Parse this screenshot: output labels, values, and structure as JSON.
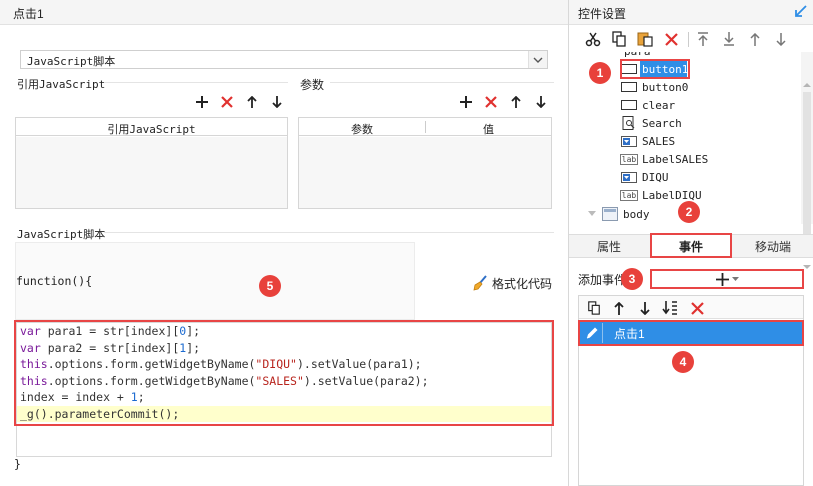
{
  "left": {
    "title": "点击1",
    "script_type_select": {
      "value": "JavaScript脚本"
    },
    "ref_js": {
      "title": "引用JavaScript",
      "column": "引用JavaScript"
    },
    "params": {
      "title": "参数",
      "columns": [
        "参数",
        "值"
      ]
    },
    "script_section_title": "JavaScript脚本",
    "function_header": "function(){",
    "format_code_label": "格式化代码",
    "closing_brace": "}",
    "code_lines": [
      "var para1 = str[index][0];",
      "var para2 = str[index][1];",
      "this.options.form.getWidgetByName(\"DIQU\").setValue(para1);",
      "this.options.form.getWidgetByName(\"SALES\").setValue(para2);",
      "index = index + 1;",
      "_g().parameterCommit();"
    ]
  },
  "right": {
    "title": "控件设置",
    "tree_items": [
      {
        "label": "para",
        "icon": "form-icon"
      },
      {
        "label": "button1",
        "icon": "button-icon"
      },
      {
        "label": "button0",
        "icon": "button-icon"
      },
      {
        "label": "clear",
        "icon": "button-icon"
      },
      {
        "label": "Search",
        "icon": "search-widget-icon"
      },
      {
        "label": "SALES",
        "icon": "combo-icon"
      },
      {
        "label": "LabelSALES",
        "icon": "label-icon"
      },
      {
        "label": "DIQU",
        "icon": "combo-icon"
      },
      {
        "label": "LabelDIQU",
        "icon": "label-icon"
      },
      {
        "label": "body",
        "icon": "form-icon"
      }
    ],
    "label_icon_text": "lab",
    "tabs": [
      "属性",
      "事件",
      "移动端"
    ],
    "active_tab": "事件",
    "add_event_label": "添加事件",
    "event_items": [
      {
        "label": "点击1"
      }
    ]
  },
  "badges": [
    "1",
    "2",
    "3",
    "4",
    "5"
  ],
  "colors": {
    "accent_blue": "#2f8ee6",
    "annotation_red": "#e84545",
    "code_highlight": "#ffffcc"
  }
}
